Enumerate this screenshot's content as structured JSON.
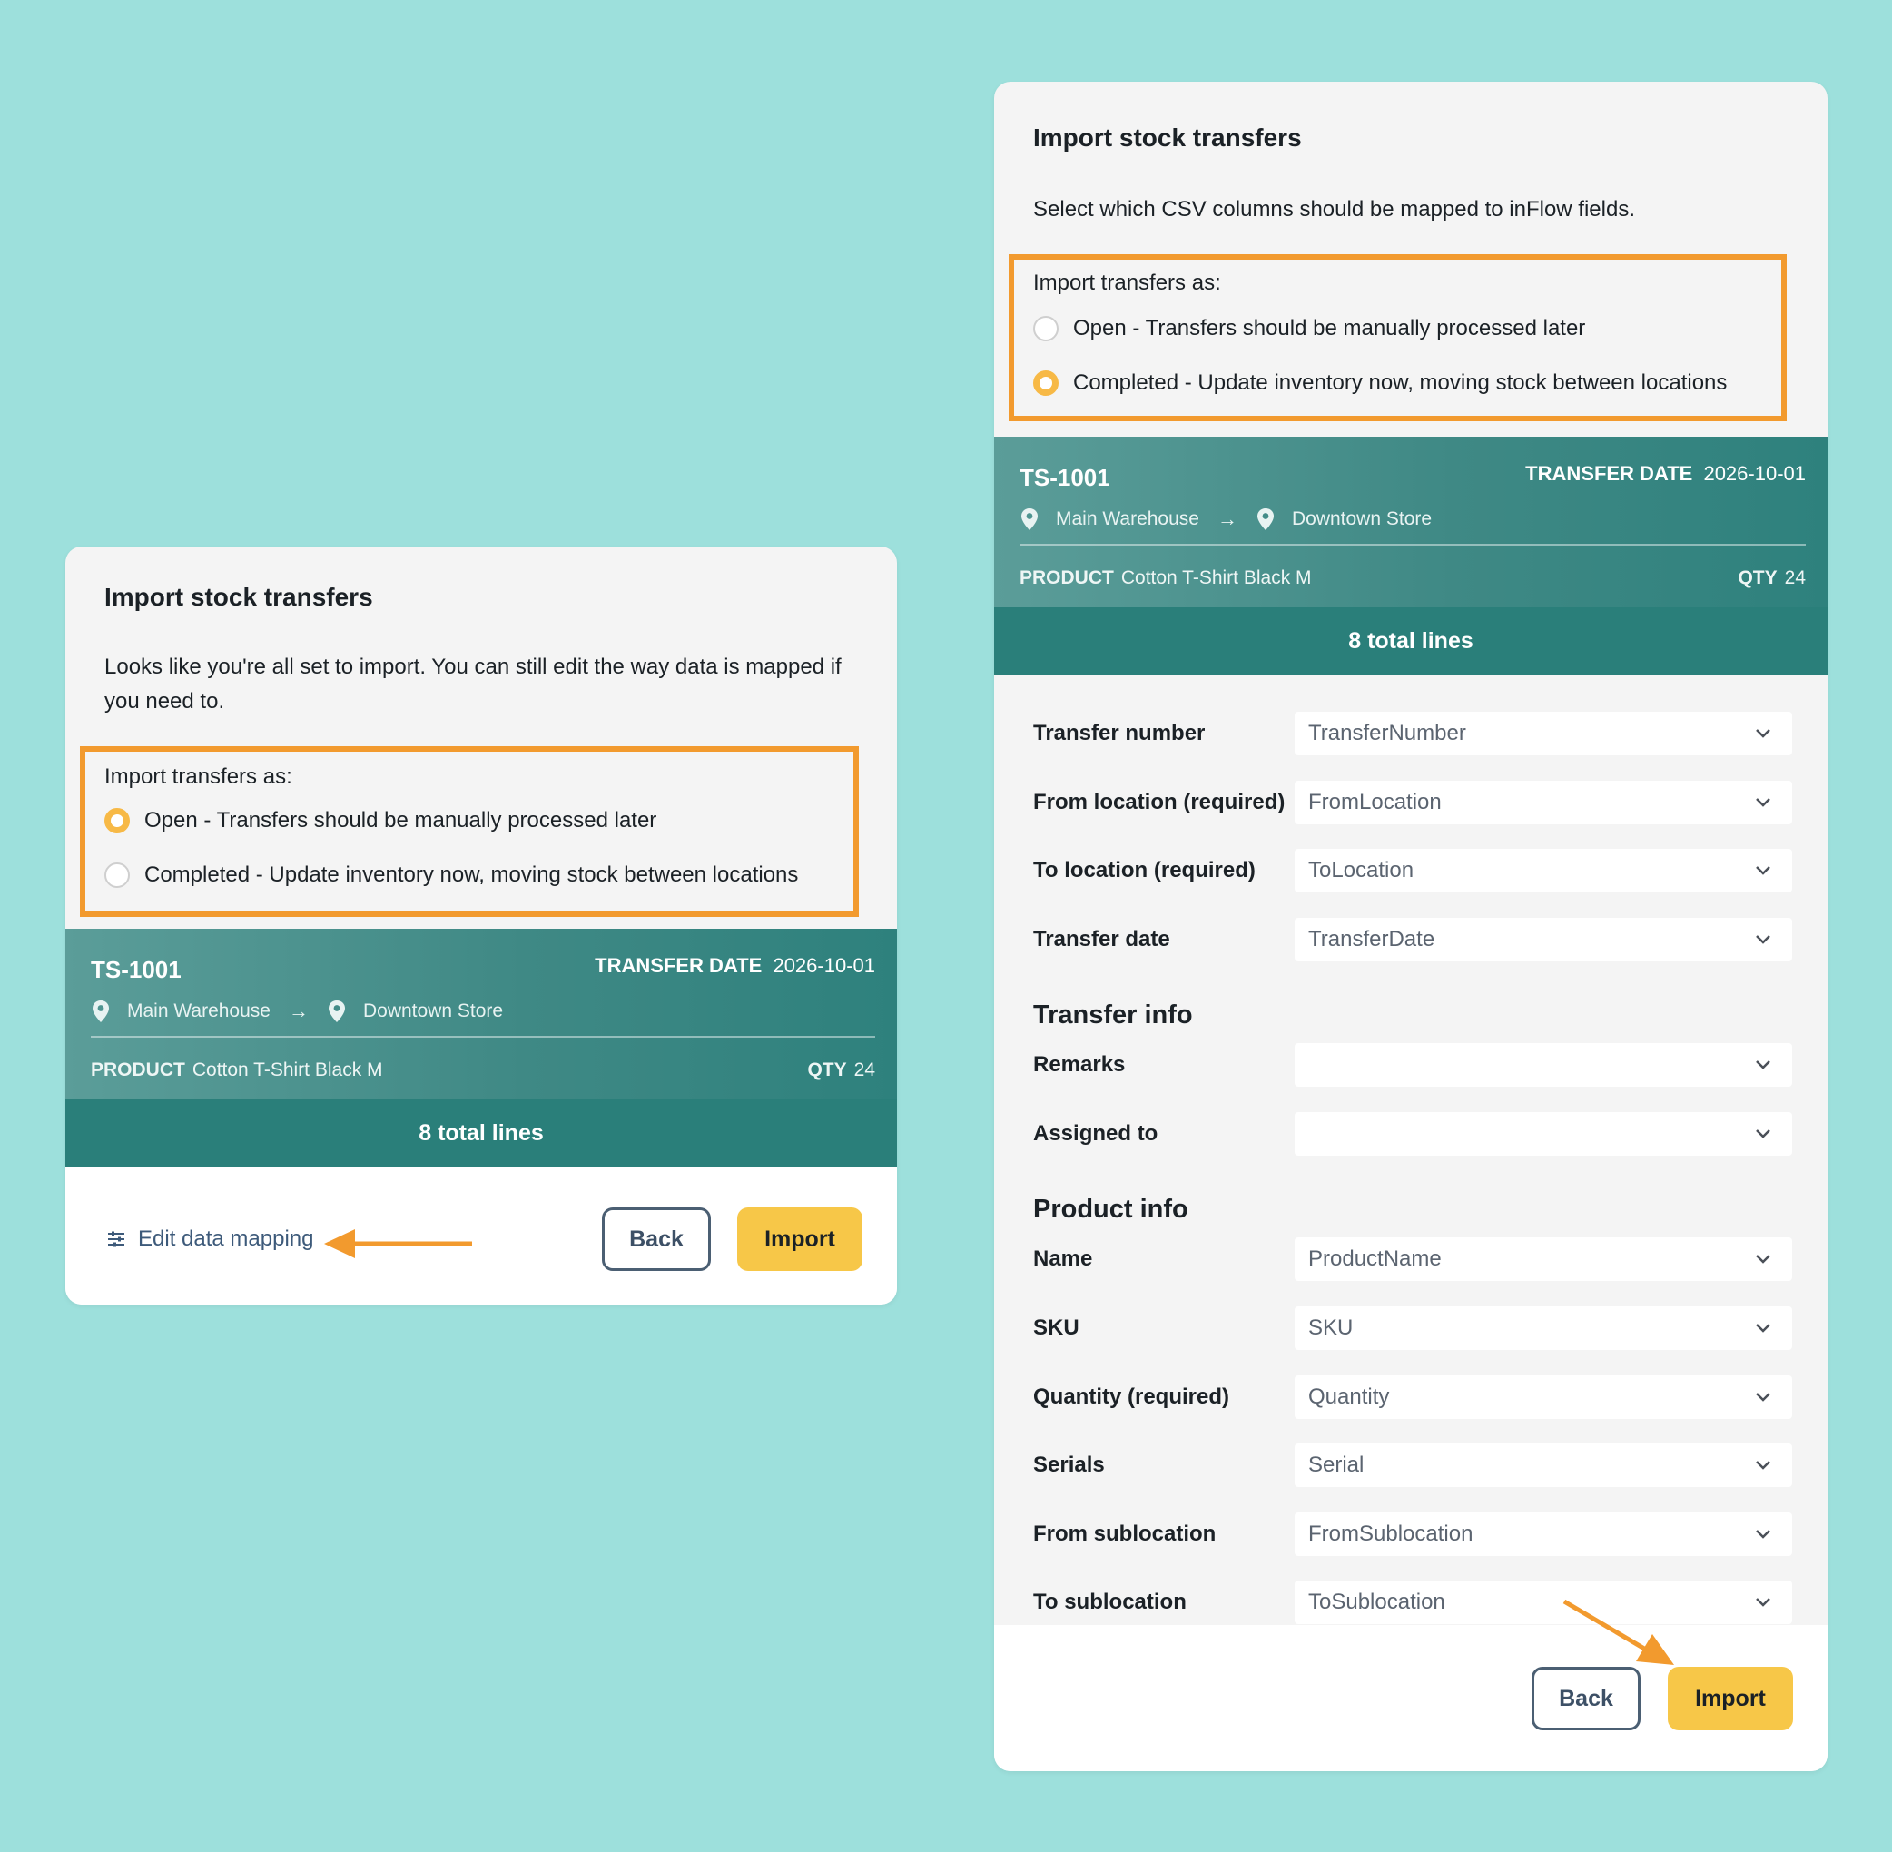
{
  "colors": {
    "background": "#9de0dc",
    "highlight": "#f29a2e",
    "teal_dark": "#2a7f7a",
    "import_button": "#f7c748",
    "radio_selected": "#f7b946"
  },
  "left": {
    "title": "Import stock transfers",
    "description": "Looks like you're all set to import. You can still edit the way data is mapped if you need to.",
    "options_heading": "Import transfers as:",
    "options": [
      {
        "label": "Open - Transfers should be manually processed later",
        "selected": true
      },
      {
        "label": "Completed - Update inventory now, moving stock between locations",
        "selected": false
      }
    ],
    "transfer": {
      "number": "TS-1001",
      "date_label": "TRANSFER DATE",
      "date_value": "2026-10-01",
      "from": "Main Warehouse",
      "arrow": "→",
      "to": "Downtown Store",
      "product_label": "PRODUCT",
      "product_value": "Cotton T-Shirt Black M",
      "qty_label": "QTY",
      "qty_value": "24"
    },
    "total_lines": "8 total lines",
    "edit_mapping": "Edit data mapping",
    "back": "Back",
    "import": "Import"
  },
  "right": {
    "title": "Import stock transfers",
    "description": "Select which CSV columns should be mapped to inFlow fields.",
    "options_heading": "Import transfers as:",
    "options": [
      {
        "label": "Open - Transfers should be manually processed later",
        "selected": false
      },
      {
        "label": "Completed - Update inventory now, moving stock between locations",
        "selected": true
      }
    ],
    "transfer": {
      "number": "TS-1001",
      "date_label": "TRANSFER DATE",
      "date_value": "2026-10-01",
      "from": "Main Warehouse",
      "arrow": "→",
      "to": "Downtown Store",
      "product_label": "PRODUCT",
      "product_value": "Cotton T-Shirt Black M",
      "qty_label": "QTY",
      "qty_value": "24"
    },
    "total_lines": "8 total lines",
    "mapping": [
      {
        "label": "Transfer number",
        "value": "TransferNumber"
      },
      {
        "label": "From location (required)",
        "value": "FromLocation"
      },
      {
        "label": "To location (required)",
        "value": "ToLocation"
      },
      {
        "label": "Transfer date",
        "value": "TransferDate"
      }
    ],
    "transfer_info_heading": "Transfer info",
    "transfer_info": [
      {
        "label": "Remarks",
        "value": ""
      },
      {
        "label": "Assigned to",
        "value": ""
      }
    ],
    "product_info_heading": "Product info",
    "product_info": [
      {
        "label": "Name",
        "value": "ProductName"
      },
      {
        "label": "SKU",
        "value": "SKU"
      },
      {
        "label": "Quantity (required)",
        "value": "Quantity"
      },
      {
        "label": "Serials",
        "value": "Serial"
      },
      {
        "label": "From sublocation",
        "value": "FromSublocation"
      },
      {
        "label": "To sublocation",
        "value": "ToSublocation"
      }
    ],
    "back": "Back",
    "import": "Import"
  }
}
